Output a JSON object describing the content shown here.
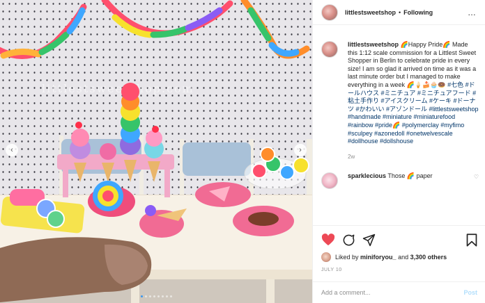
{
  "header": {
    "username": "littlestsweetshop",
    "separator": "•",
    "follow_status": "Following",
    "more_icon": "…"
  },
  "photo": {
    "watermark": "littlestsweetshop.com",
    "prev_icon": "‹",
    "next_icon": "›",
    "slide_count": 8,
    "active_slide": 1
  },
  "caption": {
    "username": "littlestsweetshop",
    "text": "🌈Happy Pride🌈 Made this 1:12 scale commission for a Littlest Sweet Shopper in Berlin to celebrate pride in every size! I am so glad it arrived on time as it was a last minute order but I managed to make everything in a week 🌈🍦🍰🧁🍩",
    "hashtags": "#七色 #ドールハウス #ミニチュア #ミニチュアフード #粘土手作り #アイスクリーム #ケーキ #ドーナツ #かわいい #アゾンドール #littlestsweetshop #handmade #miniature #miniaturefood #rainbow #pride🌈 #polymerclay #myfimo #sculpey #azonedoll #onetwelvescale #dollhouse #dollshouse",
    "age": "2w"
  },
  "reply": {
    "username": "sparklecious",
    "text": "Those 🌈 paper"
  },
  "likes": {
    "prefix": "Liked by",
    "user": "miniforyou_",
    "middle": "and",
    "count": "3,300 others"
  },
  "date": "JULY 10",
  "comment_box": {
    "placeholder": "Add a comment...",
    "post_label": "Post"
  },
  "colors": {
    "link": "#003569",
    "like_red": "#ed4956",
    "post_disabled": "#b2dffc",
    "active_dot": "#3897f0"
  }
}
